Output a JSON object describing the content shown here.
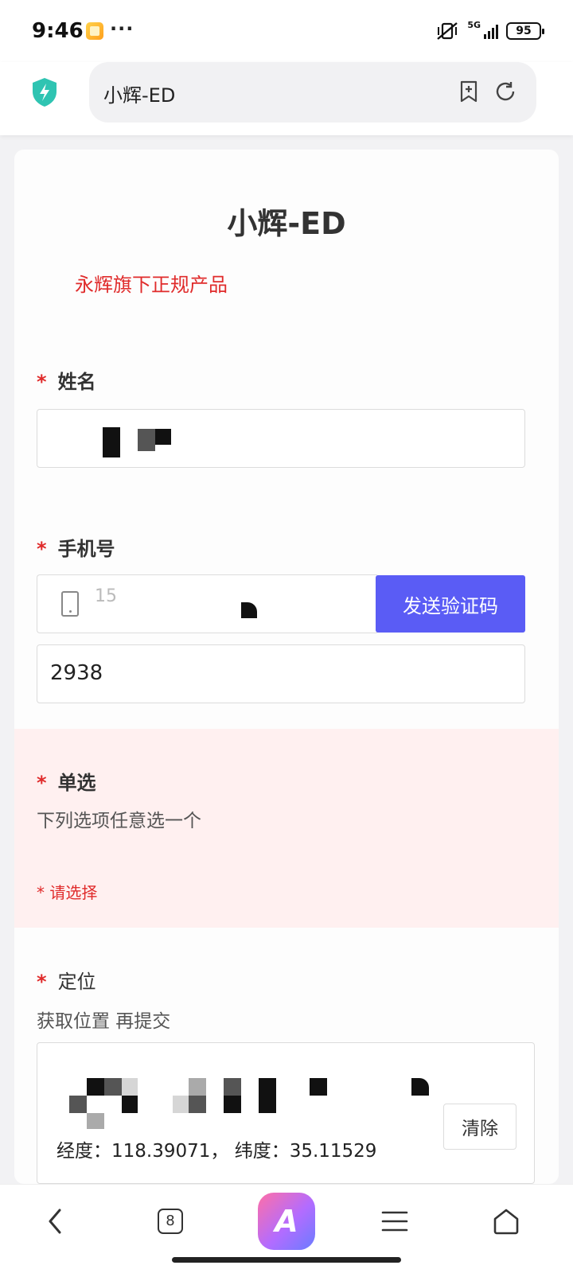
{
  "status_bar": {
    "time": "9:46",
    "more": "···",
    "network": "5G",
    "battery": "95"
  },
  "browser": {
    "address": "小辉-ED",
    "icons": [
      "shield-lightning-icon",
      "bookmark-add-icon",
      "refresh-icon"
    ]
  },
  "form": {
    "title": "小辉-ED",
    "subtitle": "永辉旗下正规产品",
    "required_mark": "*",
    "name_question": {
      "label": "姓名"
    },
    "phone_question": {
      "label": "手机号",
      "phone_partial": "15",
      "send_code_label": "发送验证码",
      "code_value": "2938"
    },
    "choice_question": {
      "label": "单选",
      "description": "下列选项任意选一个",
      "error": "* 请选择"
    },
    "location_question": {
      "label": "定位",
      "description": "获取位置 再提交",
      "clear_label": "清除",
      "coords": "经度：118.39071， 纬度：35.11529"
    }
  },
  "bottom_nav": {
    "tab_count": "8",
    "ai_label": "A"
  },
  "colors": {
    "accent": "#5a5cf5",
    "required": "#e02b2b",
    "error_bg": "#fff0f0"
  }
}
